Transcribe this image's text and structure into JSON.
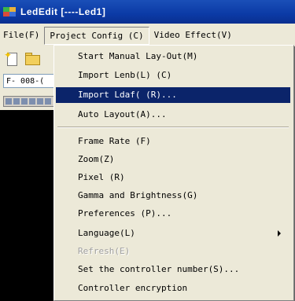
{
  "window": {
    "title": "LedEdit [----Led1]"
  },
  "menubar": {
    "items": [
      {
        "label": "File(F)"
      },
      {
        "label": "Project Config (C)"
      },
      {
        "label": "Video Effect(V)"
      }
    ]
  },
  "combo": {
    "value": "F- 008-("
  },
  "dropdown": {
    "items": [
      {
        "label": "Start Manual Lay-Out(M)"
      },
      {
        "label": "Import Lenb(L)  (C)"
      },
      {
        "label": "Import Ldaf(  (R)..."
      },
      {
        "label": "Auto Layout(A)..."
      },
      {
        "label": "Frame Rate (F)"
      },
      {
        "label": "Zoom(Z)"
      },
      {
        "label": "Pixel (R)"
      },
      {
        "label": "Gamma and Brightness(G)"
      },
      {
        "label": "Preferences (P)..."
      },
      {
        "label": "Language(L)"
      },
      {
        "label": "Refresh(E)"
      },
      {
        "label": "Set the controller number(S)..."
      },
      {
        "label": "Controller encryption"
      }
    ]
  },
  "colors": {
    "highlight": "#0b246a",
    "menu_background": "#ece9d8",
    "title_bar": "#0b3aa6"
  },
  "icons": {
    "new": "new-file-icon",
    "open": "open-folder-icon",
    "submenu": "submenu-arrow-icon"
  }
}
